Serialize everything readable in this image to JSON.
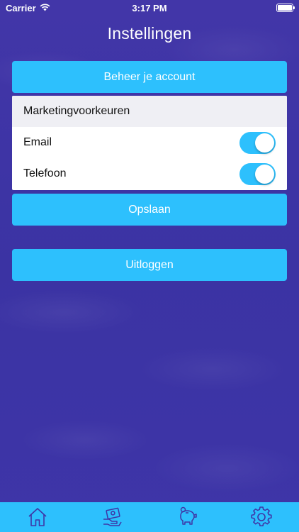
{
  "status_bar": {
    "carrier": "Carrier",
    "time": "3:17 PM"
  },
  "page": {
    "title": "Instellingen"
  },
  "account_button": {
    "label": "Beheer je account"
  },
  "preferences": {
    "header": "Marketingvoorkeuren",
    "items": [
      {
        "label": "Email",
        "enabled": true
      },
      {
        "label": "Telefoon",
        "enabled": true
      }
    ]
  },
  "save_button": {
    "label": "Opslaan"
  },
  "logout_button": {
    "label": "Uitloggen"
  },
  "tab_bar": {
    "tabs": [
      {
        "icon": "home-icon"
      },
      {
        "icon": "cash-icon"
      },
      {
        "icon": "piggy-bank-icon"
      },
      {
        "icon": "gear-icon",
        "active": true
      }
    ]
  },
  "colors": {
    "background": "#3f35a6",
    "accent": "#2dc0fd",
    "text_on_accent": "#ffffff"
  }
}
